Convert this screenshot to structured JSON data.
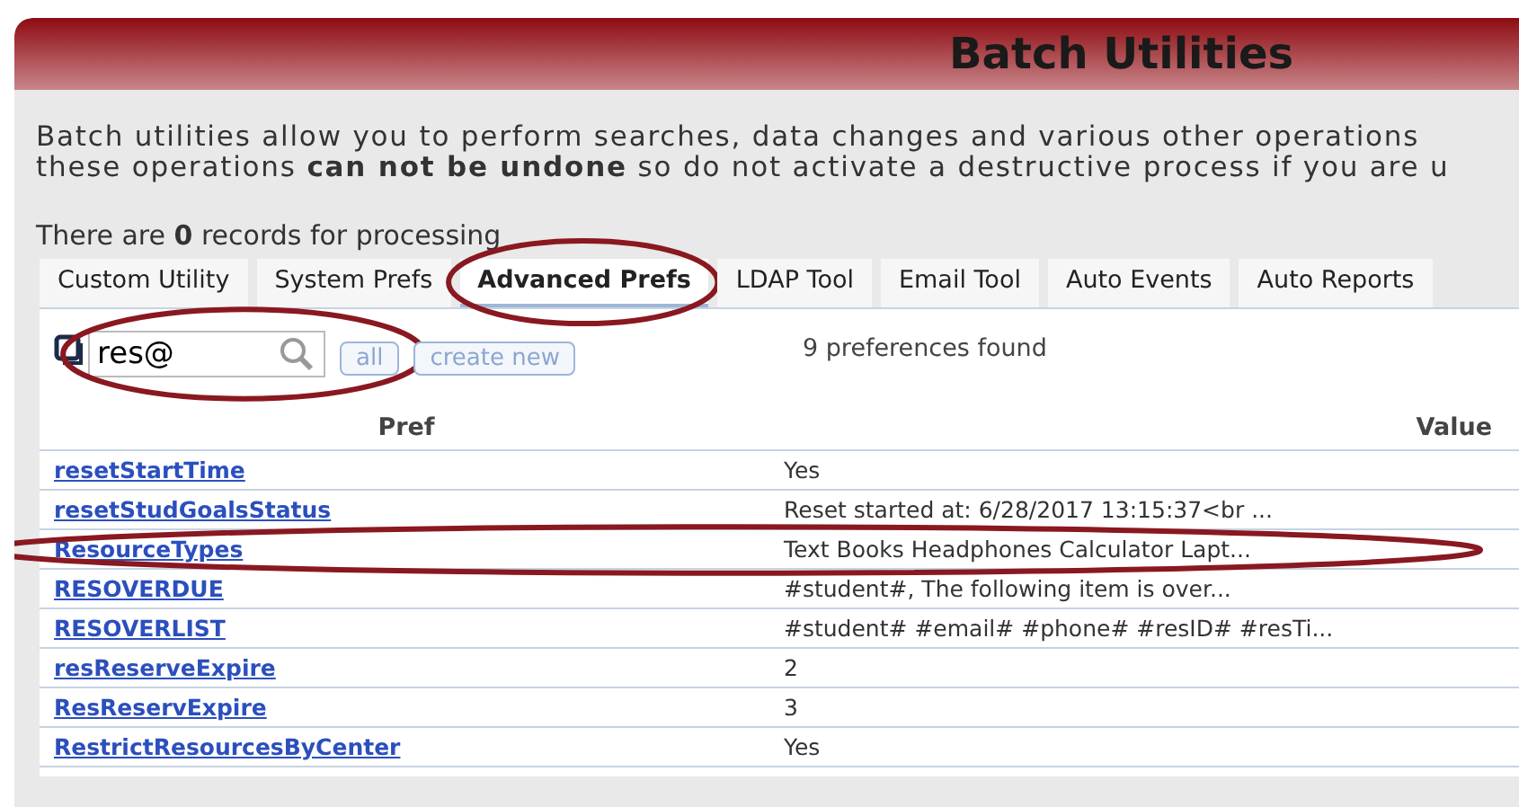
{
  "header": {
    "title": "Batch Utilities"
  },
  "description": [
    "Batch utilities allow you to perform searches, data changes and various other operations",
    "these operations **can not be undone** so do not activate a destructive process if you are u"
  ],
  "records_line": "There are **0** records for processing",
  "tabs": [
    {
      "label": "Custom Utility",
      "selected": false,
      "circled": false
    },
    {
      "label": "System Prefs",
      "selected": false,
      "circled": false
    },
    {
      "label": "Advanced Prefs",
      "selected": true,
      "circled": true
    },
    {
      "label": "LDAP Tool",
      "selected": false,
      "circled": false
    },
    {
      "label": "Email Tool",
      "selected": false,
      "circled": false
    },
    {
      "label": "Auto Events",
      "selected": false,
      "circled": false
    },
    {
      "label": "Auto Reports",
      "selected": false,
      "circled": false
    }
  ],
  "search": {
    "value": "res@",
    "circled": true
  },
  "buttons": [
    "all",
    "create new"
  ],
  "found": "9 preferences found",
  "table": {
    "columns": [
      "Pref",
      "Value"
    ],
    "rows": [
      {
        "pref": "resetStartTime",
        "value": "Yes",
        "circled": false
      },
      {
        "pref": "resetStudGoalsStatus",
        "value": "Reset started at: 6/28/2017 13:15:37<br ...",
        "circled": false
      },
      {
        "pref": "ResourceTypes",
        "value": "Text Books Headphones Calculator Lapt...",
        "circled": true
      },
      {
        "pref": "RESOVERDUE",
        "value": "#student#, The following item is over...",
        "circled": false
      },
      {
        "pref": "RESOVERLIST",
        "value": "#student# #email# #phone# #resID# #resTi...",
        "circled": false
      },
      {
        "pref": "resReserveExpire",
        "value": "2",
        "circled": false
      },
      {
        "pref": "ResReservExpire",
        "value": "3",
        "circled": false
      },
      {
        "pref": "RestrictResourcesByCenter",
        "value": "Yes",
        "circled": false
      }
    ]
  }
}
